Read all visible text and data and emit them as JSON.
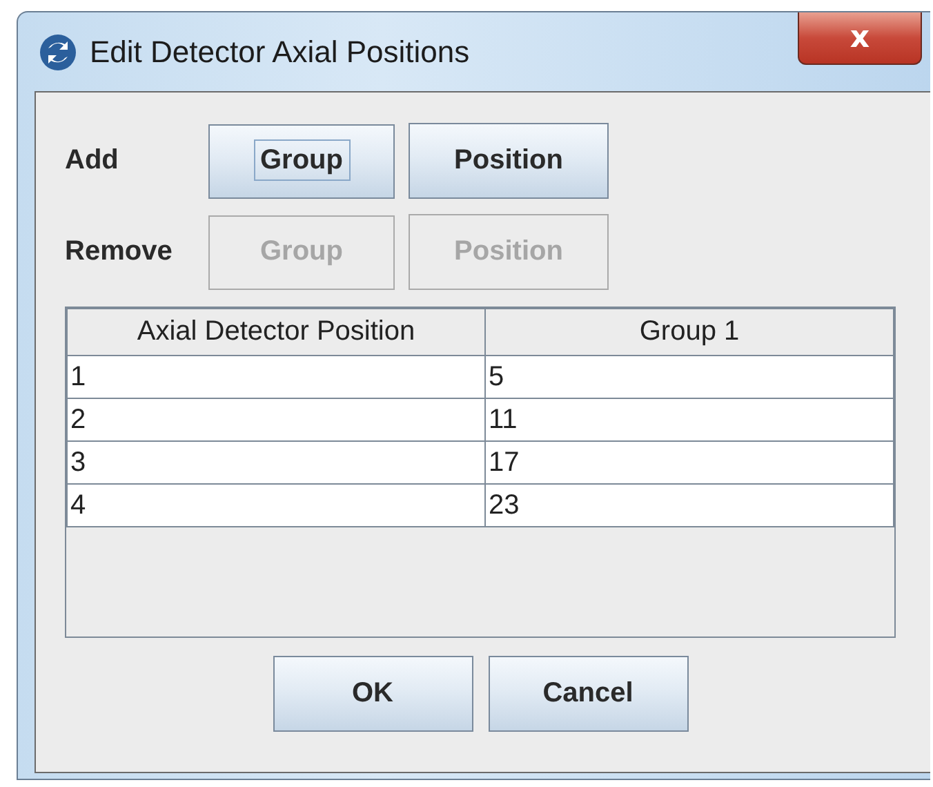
{
  "window": {
    "title": "Edit Detector Axial Positions",
    "close": "x"
  },
  "button_rows": [
    {
      "label": "Add",
      "buttons": [
        {
          "label": "Group",
          "disabled": false,
          "focused": true
        },
        {
          "label": "Position",
          "disabled": false,
          "focused": false
        }
      ]
    },
    {
      "label": "Remove",
      "buttons": [
        {
          "label": "Group",
          "disabled": true,
          "focused": false
        },
        {
          "label": "Position",
          "disabled": true,
          "focused": false
        }
      ]
    }
  ],
  "table": {
    "columns": [
      "Axial Detector Position",
      "Group 1"
    ],
    "rows": [
      [
        "1",
        "5"
      ],
      [
        "2",
        "11"
      ],
      [
        "3",
        "17"
      ],
      [
        "4",
        "23"
      ]
    ]
  },
  "buttons": [
    "OK",
    "Cancel"
  ]
}
